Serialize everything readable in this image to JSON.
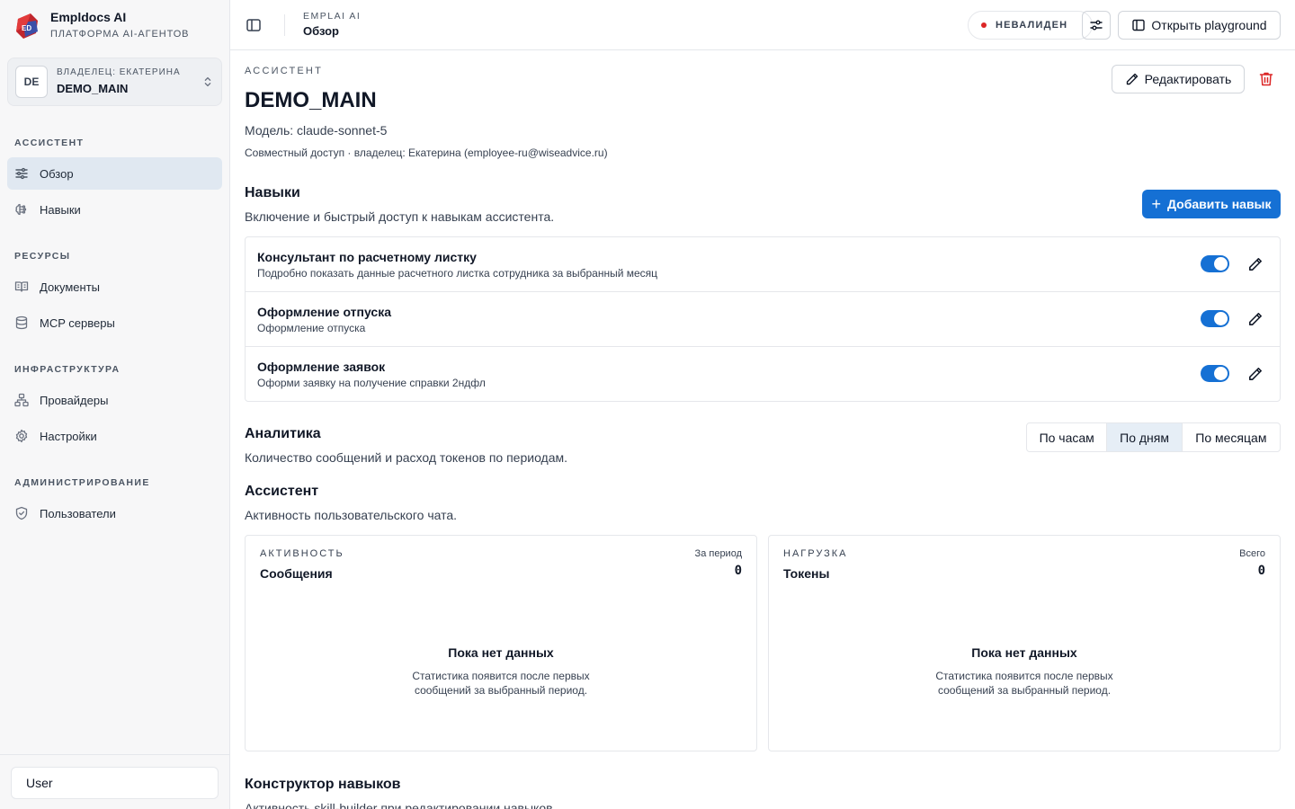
{
  "brand": {
    "name": "Empldocs AI",
    "subtitle": "ПЛАТФОРМА AI-АГЕНТОВ",
    "logo_text": "ED"
  },
  "owner": {
    "avatar": "DE",
    "label": "ВЛАДЕЛЕЦ: ЕКАТЕРИНА",
    "name": "DEMO_MAIN"
  },
  "sidebar": {
    "sections": [
      {
        "title": "АССИСТЕНТ",
        "items": [
          {
            "label": "Обзор",
            "icon": "sliders-icon",
            "active": true
          },
          {
            "label": "Навыки",
            "icon": "brain-icon",
            "active": false
          }
        ]
      },
      {
        "title": "РЕСУРСЫ",
        "items": [
          {
            "label": "Документы",
            "icon": "book-icon",
            "active": false
          },
          {
            "label": "MCP серверы",
            "icon": "database-icon",
            "active": false
          }
        ]
      },
      {
        "title": "ИНФРАСТРУКТУРА",
        "items": [
          {
            "label": "Провайдеры",
            "icon": "network-icon",
            "active": false
          },
          {
            "label": "Настройки",
            "icon": "gear-icon",
            "active": false
          }
        ]
      },
      {
        "title": "АДМИНИСТРИРОВАНИЕ",
        "items": [
          {
            "label": "Пользователи",
            "icon": "shield-icon",
            "active": false
          }
        ]
      }
    ],
    "user": "User"
  },
  "header": {
    "breadcrumb_top": "EMPLAI AI",
    "breadcrumb_main": "Обзор",
    "status": "НЕВАЛИДЕН",
    "playground_label": "Открыть playground"
  },
  "assistant": {
    "eyebrow": "АССИСТЕНТ",
    "name": "DEMO_MAIN",
    "model": "Модель: claude-sonnet-5",
    "access": "Совместный доступ · владелец: Екатерина (employee-ru@wiseadvice.ru)",
    "edit_label": "Редактировать"
  },
  "skills": {
    "title": "Навыки",
    "subtitle": "Включение и быстрый доступ к навыкам ассистента.",
    "add_label": "Добавить навык",
    "items": [
      {
        "name": "Консультант по расчетному листку",
        "desc": "Подробно показать данные расчетного листка сотрудника за выбранный месяц",
        "enabled": true
      },
      {
        "name": "Оформление отпуска",
        "desc": "Оформление отпуска",
        "enabled": true
      },
      {
        "name": "Оформление заявок",
        "desc": "Оформи заявку на получение справки 2ндфл",
        "enabled": true
      }
    ]
  },
  "analytics": {
    "title": "Аналитика",
    "subtitle": "Количество сообщений и расход токенов по периодам.",
    "periods": [
      "По часам",
      "По дням",
      "По месяцам"
    ],
    "active_period": "По дням",
    "assistant_title": "Ассистент",
    "assistant_subtitle": "Активность пользовательского чата.",
    "cards": [
      {
        "eyebrow": "АКТИВНОСТЬ",
        "title": "Сообщения",
        "period_label": "За период",
        "value": "0",
        "empty_title": "Пока нет данных",
        "empty_sub": "Статистика появится после первых сообщений за выбранный период."
      },
      {
        "eyebrow": "НАГРУЗКА",
        "title": "Токены",
        "period_label": "Всего",
        "value": "0",
        "empty_title": "Пока нет данных",
        "empty_sub": "Статистика появится после первых сообщений за выбранный период."
      }
    ],
    "builder_title": "Конструктор навыков",
    "builder_subtitle": "Активность skill-builder при редактировании навыков."
  },
  "colors": {
    "accent": "#1570d4",
    "danger": "#dc2626",
    "sidebar_bg": "#f7f7f8",
    "active_nav": "#e0e8f1"
  }
}
